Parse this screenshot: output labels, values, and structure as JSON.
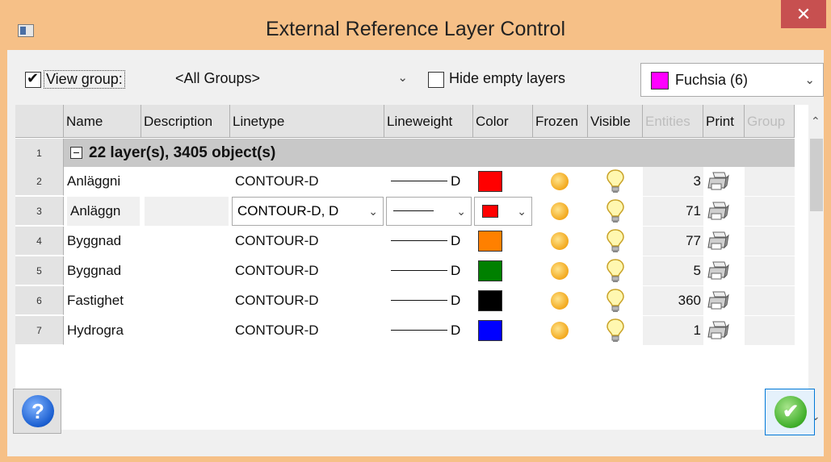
{
  "window": {
    "title": "External Reference Layer Control",
    "close_label": "✕"
  },
  "toolbar": {
    "view_group_label": "View group:",
    "view_group_checked": true,
    "groups_value": "<All Groups>",
    "hide_empty_label": "Hide empty layers",
    "hide_empty_checked": false,
    "color_value": "Fuchsia (6)",
    "color_hex": "#ff00ff"
  },
  "columns": [
    "Name",
    "Description",
    "Linetype",
    "Lineweight",
    "Color",
    "Frozen",
    "Visible",
    "Entities",
    "Print",
    "Group"
  ],
  "group_row": {
    "number": "1",
    "label": "22 layer(s), 3405 object(s)"
  },
  "rows": [
    {
      "number": "2",
      "name": "Anläggni",
      "description": "",
      "linetype": "CONTOUR-D",
      "lineweight": "D",
      "color": "#ff0000",
      "entities": "3"
    },
    {
      "number": "3",
      "name": "Anläggn",
      "description": "",
      "linetype": "CONTOUR-D, D",
      "lineweight": "",
      "color": "#ff0000",
      "entities": "71"
    },
    {
      "number": "4",
      "name": "Byggnad",
      "description": "",
      "linetype": "CONTOUR-D",
      "lineweight": "D",
      "color": "#ff8000",
      "entities": "77"
    },
    {
      "number": "5",
      "name": "Byggnad",
      "description": "",
      "linetype": "CONTOUR-D",
      "lineweight": "D",
      "color": "#008000",
      "entities": "5"
    },
    {
      "number": "6",
      "name": "Fastighet",
      "description": "",
      "linetype": "CONTOUR-D",
      "lineweight": "D",
      "color": "#000000",
      "entities": "360"
    },
    {
      "number": "7",
      "name": "Hydrogra",
      "description": "",
      "linetype": "CONTOUR-D",
      "lineweight": "D",
      "color": "#0000ff",
      "entities": "1"
    }
  ],
  "buttons": {
    "help_label": "?",
    "ok_label": "✔"
  }
}
